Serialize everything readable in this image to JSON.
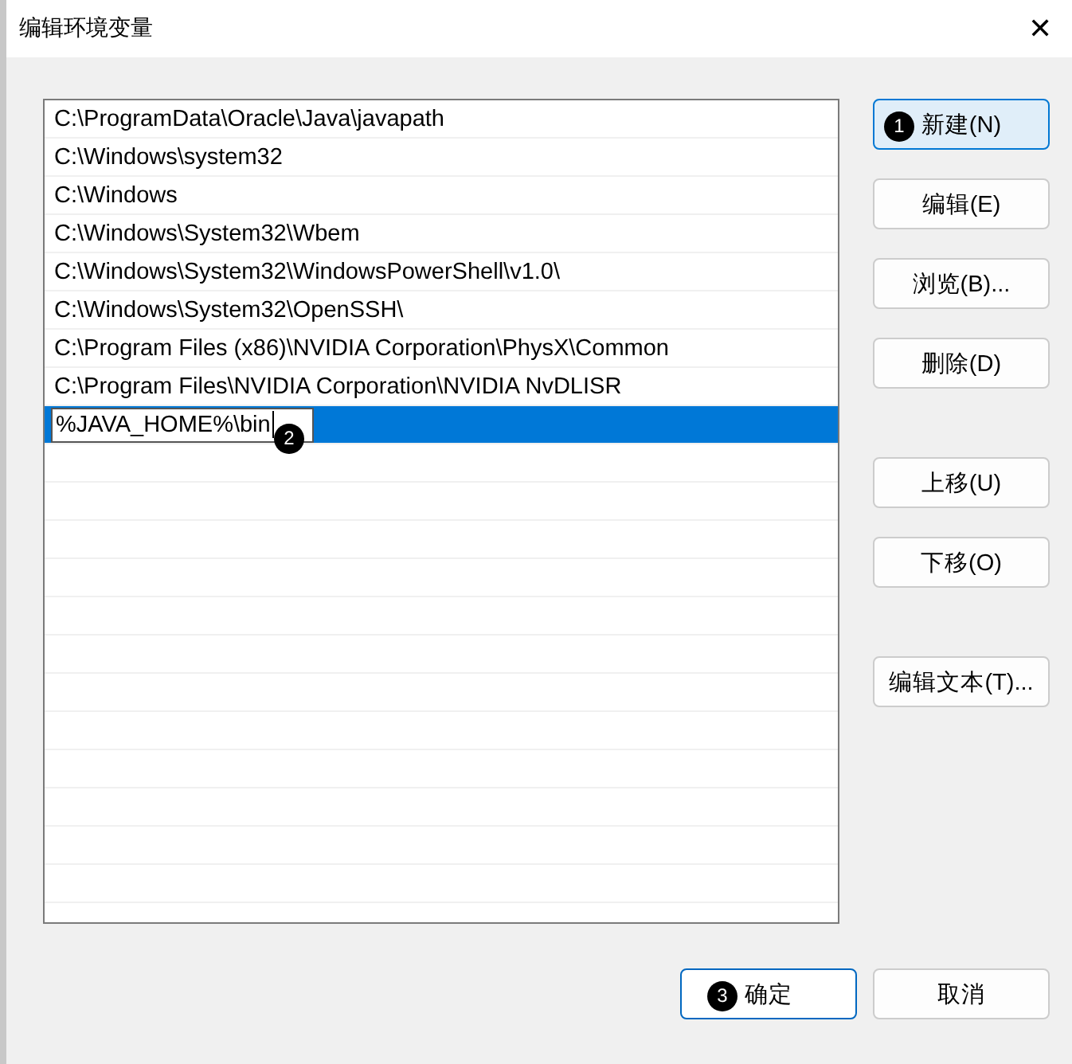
{
  "window": {
    "title": "编辑环境变量",
    "close": "✕"
  },
  "paths": [
    {
      "kind": "text",
      "text": "C:\\ProgramData\\Oracle\\Java\\javapath",
      "selected": false
    },
    {
      "kind": "text",
      "text": "C:\\Windows\\system32",
      "selected": false
    },
    {
      "kind": "text",
      "text": "C:\\Windows",
      "selected": false
    },
    {
      "kind": "text",
      "text": "C:\\Windows\\System32\\Wbem",
      "selected": false
    },
    {
      "kind": "text",
      "text": "C:\\Windows\\System32\\WindowsPowerShell\\v1.0\\",
      "selected": false
    },
    {
      "kind": "text",
      "text": "C:\\Windows\\System32\\OpenSSH\\",
      "selected": false
    },
    {
      "kind": "text",
      "text": "C:\\Program Files (x86)\\NVIDIA Corporation\\PhysX\\Common",
      "selected": false
    },
    {
      "kind": "text",
      "text": "C:\\Program Files\\NVIDIA Corporation\\NVIDIA NvDLISR",
      "selected": false
    },
    {
      "kind": "editing",
      "value": "%JAVA_HOME%\\bin",
      "selected": true,
      "badge": "2"
    }
  ],
  "side_button_groups": [
    [
      {
        "label": "新建(N)",
        "hovered": true,
        "badge": "1"
      },
      {
        "label": "编辑(E)",
        "hovered": false
      },
      {
        "label": "浏览(B)...",
        "hovered": false
      },
      {
        "label": "删除(D)",
        "hovered": false
      }
    ],
    [
      {
        "label": "上移(U)",
        "hovered": false
      },
      {
        "label": "下移(O)",
        "hovered": false
      }
    ],
    [
      {
        "label": "编辑文本(T)...",
        "hovered": false
      }
    ]
  ],
  "footer_buttons": [
    {
      "label": "确定",
      "default": true,
      "badge": "3"
    },
    {
      "label": "取消",
      "default": false
    }
  ]
}
